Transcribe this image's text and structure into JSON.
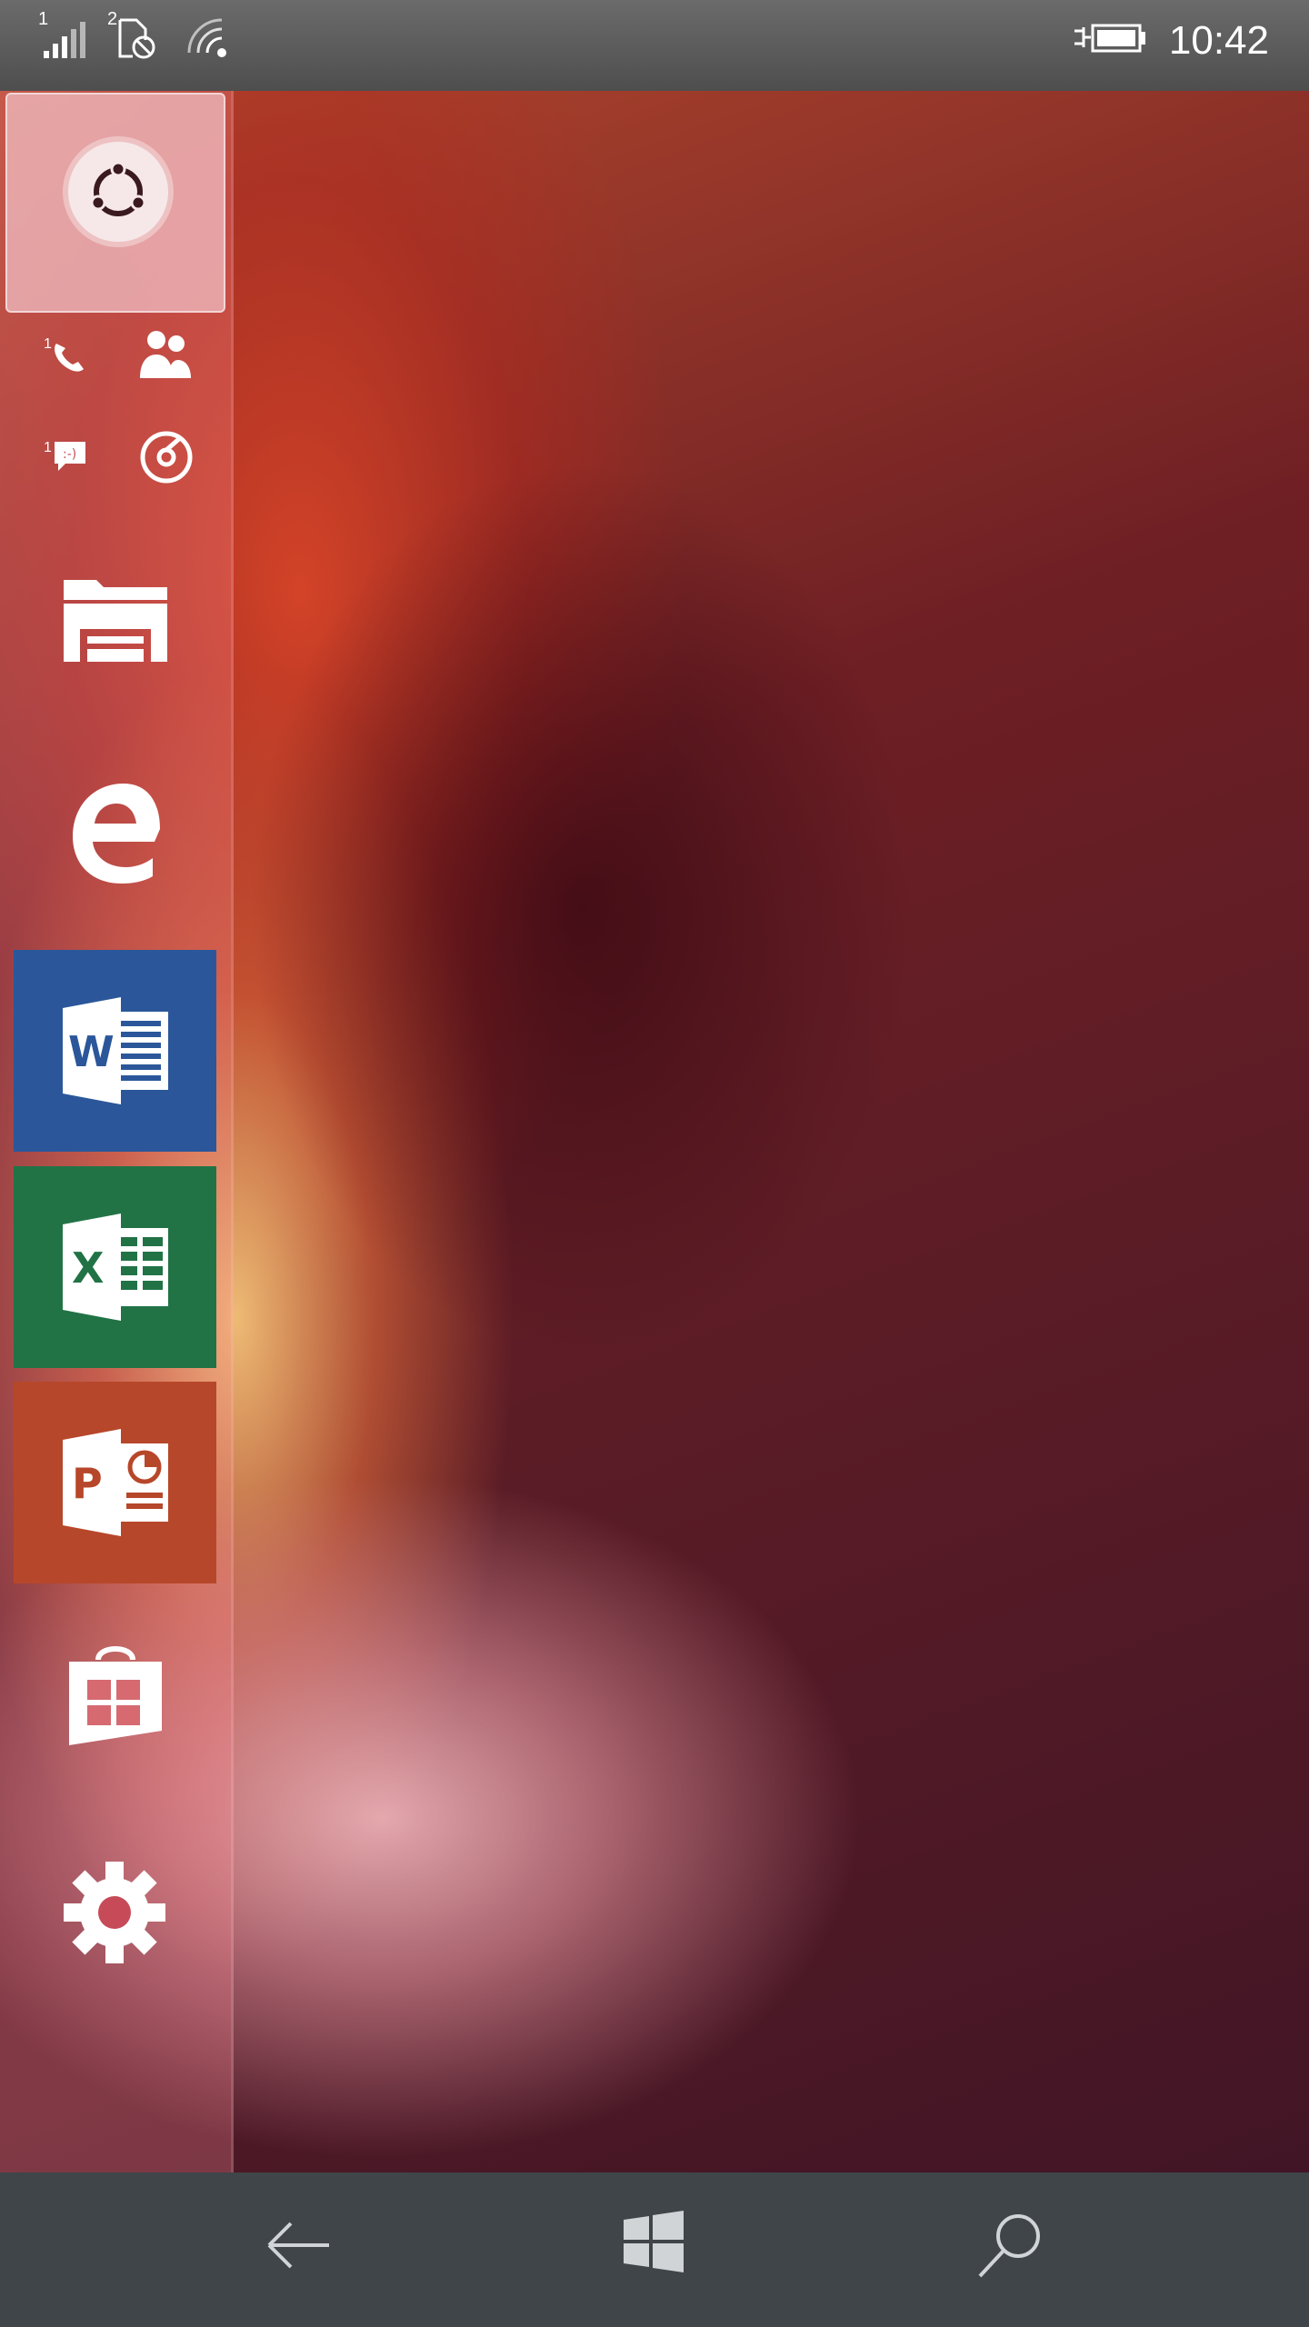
{
  "status_bar": {
    "time": "10:42",
    "sim1_label": "1",
    "sim2_label": "2"
  },
  "rail": {
    "start_tile": "ubuntu-logo-icon",
    "phone_badge": "1",
    "messaging_badge": "1"
  },
  "apps": [
    {
      "name": "file-explorer",
      "icon": "folder-icon"
    },
    {
      "name": "edge",
      "icon": "edge-icon"
    },
    {
      "name": "word",
      "icon": "word-icon",
      "color": "#2b579a"
    },
    {
      "name": "excel",
      "icon": "excel-icon",
      "color": "#217346"
    },
    {
      "name": "powerpoint",
      "icon": "powerpoint-icon",
      "color": "#b7472a"
    },
    {
      "name": "store",
      "icon": "store-icon"
    },
    {
      "name": "settings",
      "icon": "gear-icon"
    }
  ],
  "colors": {
    "status_bar": "#5a5a5a",
    "nav_bar": "#3f4548",
    "word": "#2b579a",
    "excel": "#217346",
    "powerpoint": "#b7472a"
  }
}
